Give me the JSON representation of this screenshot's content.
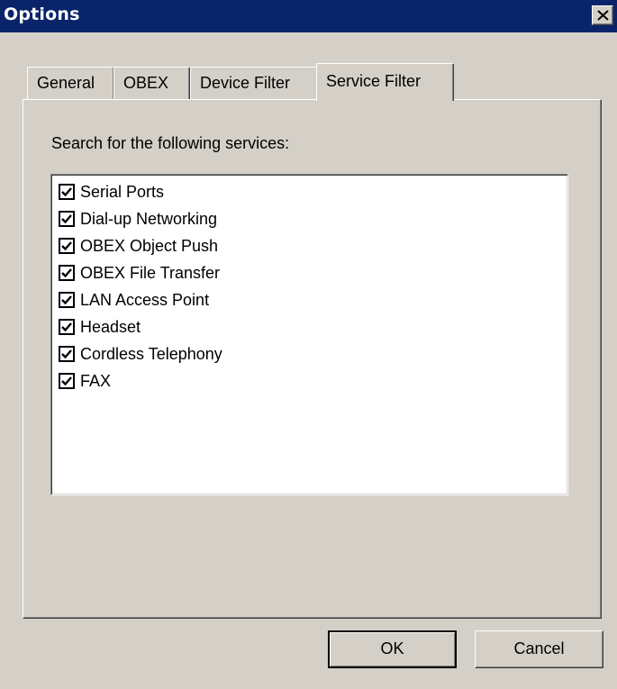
{
  "window": {
    "title": "Options"
  },
  "tabs": [
    {
      "label": "General"
    },
    {
      "label": "OBEX"
    },
    {
      "label": "Device Filter"
    },
    {
      "label": "Service Filter",
      "active": true
    }
  ],
  "service_filter": {
    "label": "Search for the following services:",
    "services": [
      {
        "label": "Serial Ports",
        "checked": true
      },
      {
        "label": "Dial-up Networking",
        "checked": true
      },
      {
        "label": "OBEX Object Push",
        "checked": true
      },
      {
        "label": "OBEX File Transfer",
        "checked": true
      },
      {
        "label": "LAN Access Point",
        "checked": true
      },
      {
        "label": "Headset",
        "checked": true
      },
      {
        "label": "Cordless Telephony",
        "checked": true
      },
      {
        "label": "FAX",
        "checked": true
      }
    ]
  },
  "buttons": {
    "ok_label": "OK",
    "cancel_label": "Cancel"
  },
  "colors": {
    "titlebar": "#0a246a",
    "face": "#d4d0c8"
  }
}
